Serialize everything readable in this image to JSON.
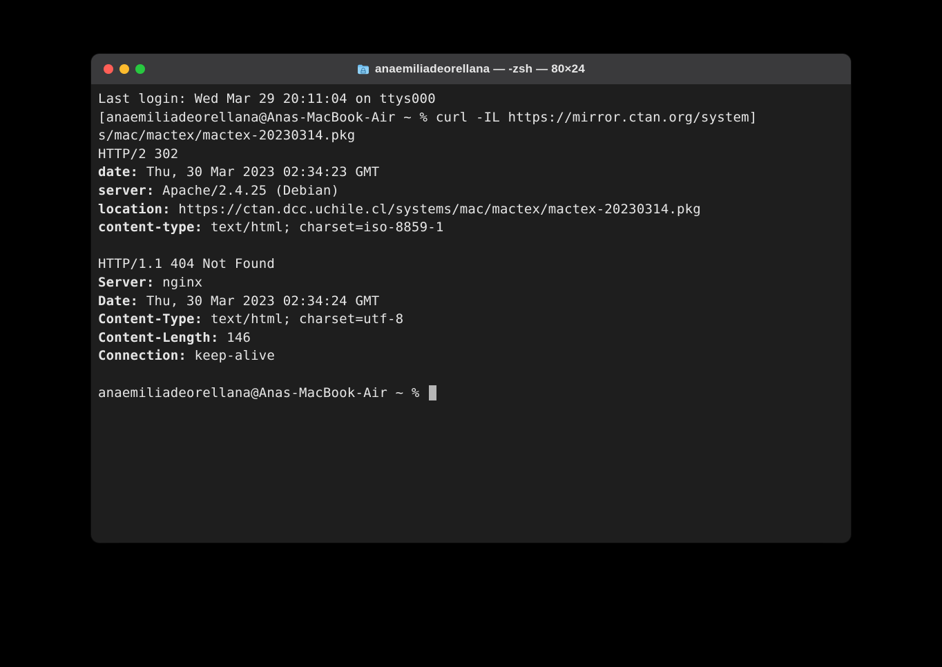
{
  "window": {
    "title": "anaemiliadeorellana — -zsh — 80×24"
  },
  "lines": {
    "last_login": "Last login: Wed Mar 29 20:11:04 on ttys000",
    "prompt1_open": "[",
    "prompt1_userhost": "anaemiliadeorellana@Anas-MacBook-Air ~ % ",
    "command1": "curl -IL https://mirror.ctan.org/system",
    "prompt1_close": "]",
    "command1_cont": "s/mac/mactex/mactex-20230314.pkg",
    "resp1_status": "HTTP/2 302 ",
    "resp1_date_k": "date:",
    "resp1_date_v": " Thu, 30 Mar 2023 02:34:23 GMT",
    "resp1_server_k": "server:",
    "resp1_server_v": " Apache/2.4.25 (Debian)",
    "resp1_location_k": "location:",
    "resp1_location_v": " https://ctan.dcc.uchile.cl/systems/mac/mactex/mactex-20230314.pkg",
    "resp1_ct_k": "content-type:",
    "resp1_ct_v": " text/html; charset=iso-8859-1",
    "resp2_status": "HTTP/1.1 404 Not Found",
    "resp2_server_k": "Server:",
    "resp2_server_v": " nginx",
    "resp2_date_k": "Date:",
    "resp2_date_v": " Thu, 30 Mar 2023 02:34:24 GMT",
    "resp2_ct_k": "Content-Type:",
    "resp2_ct_v": " text/html; charset=utf-8",
    "resp2_cl_k": "Content-Length:",
    "resp2_cl_v": " 146",
    "resp2_conn_k": "Connection:",
    "resp2_conn_v": " keep-alive",
    "prompt2": "anaemiliadeorellana@Anas-MacBook-Air ~ % "
  }
}
